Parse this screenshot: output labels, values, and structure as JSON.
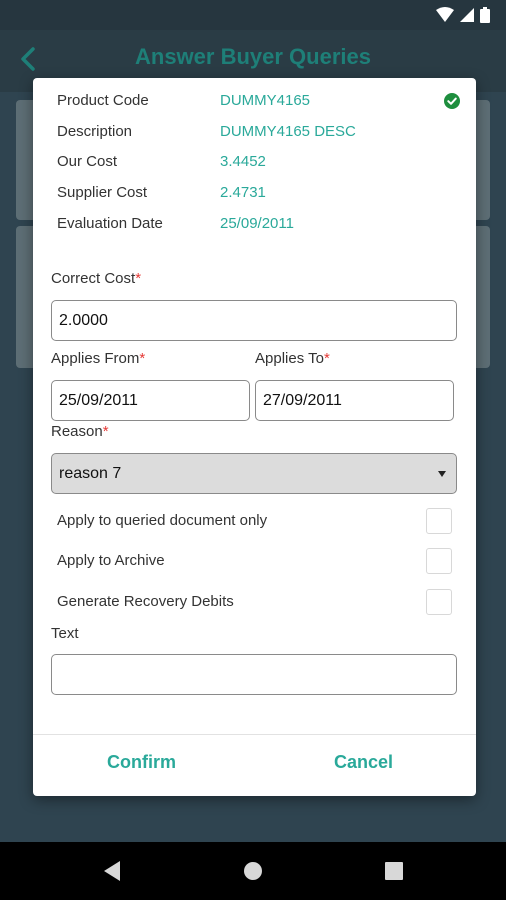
{
  "app_bar": {
    "title": "Answer Buyer Queries"
  },
  "details": [
    {
      "label": "Product Code",
      "value": "DUMMY4165"
    },
    {
      "label": "Description",
      "value": "DUMMY4165 DESC"
    },
    {
      "label": "Our Cost",
      "value": "3.4452"
    },
    {
      "label": "Supplier Cost",
      "value": "2.4731"
    },
    {
      "label": "Evaluation Date",
      "value": "25/09/2011"
    }
  ],
  "form": {
    "correct_cost": {
      "label": "Correct Cost",
      "required": "*",
      "value": "2.0000"
    },
    "applies_from": {
      "label": "Applies From",
      "required": "*",
      "value": "25/09/2011"
    },
    "applies_to": {
      "label": "Applies To",
      "required": "*",
      "value": "27/09/2011"
    },
    "reason": {
      "label": "Reason",
      "required": "*",
      "value": "reason 7"
    },
    "checkboxes": [
      {
        "label": "Apply to queried document only",
        "checked": false
      },
      {
        "label": "Apply to Archive",
        "checked": false
      },
      {
        "label": "Generate Recovery Debits",
        "checked": false
      }
    ],
    "text": {
      "label": "Text",
      "value": ""
    }
  },
  "actions": {
    "confirm": "Confirm",
    "cancel": "Cancel"
  },
  "colors": {
    "accent": "#2aa99a",
    "required": "#e53935",
    "check": "#1e8e3e"
  }
}
